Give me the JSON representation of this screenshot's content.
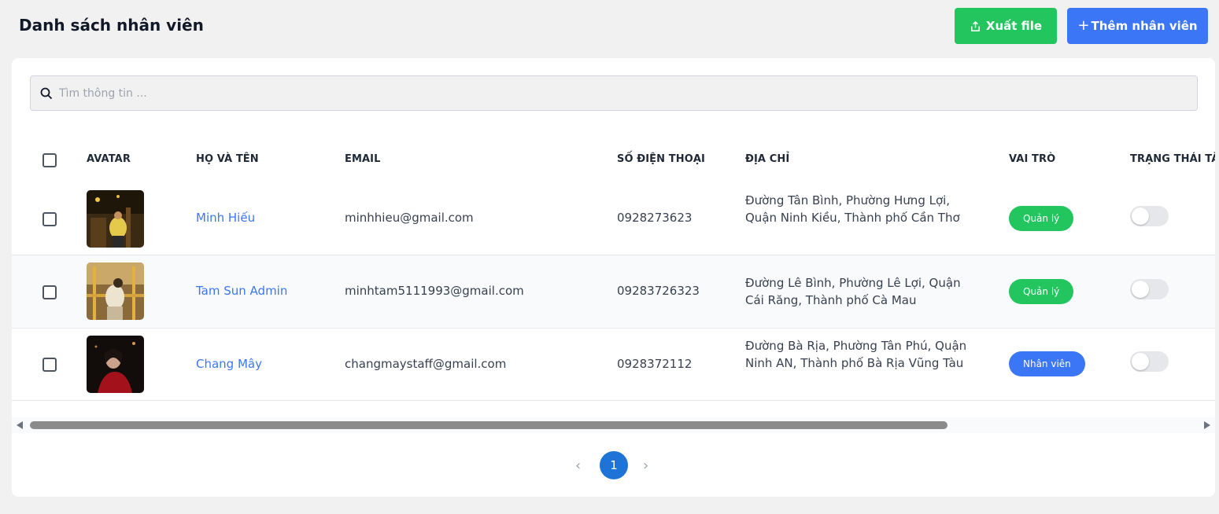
{
  "header": {
    "title": "Danh sách nhân viên",
    "export_label": "Xuất file",
    "add_label": "Thêm nhân viên",
    "add_plus": "+"
  },
  "search": {
    "placeholder": "Tìm thông tin ..."
  },
  "table": {
    "columns": [
      "AVATAR",
      "HỌ VÀ TÊN",
      "EMAIL",
      "SỐ ĐIỆN THOẠI",
      "ĐỊA CHỈ",
      "VAI TRÒ",
      "TRẠNG THÁI TÀ"
    ],
    "rows": [
      {
        "name": "Minh Hiếu",
        "email": "minhhieu@gmail.com",
        "phone": "0928273623",
        "address": "Đường Tân Bình, Phường Hưng Lợi, Quận Ninh Kiều, Thành phố Cần Thơ",
        "role": "Quản lý",
        "active": false
      },
      {
        "name": "Tam Sun Admin",
        "email": "minhtam5111993@gmail.com",
        "phone": "09283726323",
        "address": "Đường Lê Bình, Phường Lê Lợi, Quận Cái Răng, Thành phố Cà Mau",
        "role": "Quản lý",
        "active": false
      },
      {
        "name": "Chang Mây",
        "email": "changmaystaff@gmail.com",
        "phone": "0928372112",
        "address": "Đường Bà Rịa, Phường Tân Phú, Quận Ninh AN, Thành phố Bà Rịa Vũng Tàu",
        "role": "Nhân viên",
        "active": false
      }
    ]
  },
  "pagination": {
    "current": "1",
    "prev": "‹",
    "next": "›"
  },
  "colors": {
    "export_button": "#22c55e",
    "add_button": "#3b76f6",
    "role_manager": "#22c55e",
    "role_staff": "#3b76f6",
    "page_active": "#1d74d6"
  }
}
